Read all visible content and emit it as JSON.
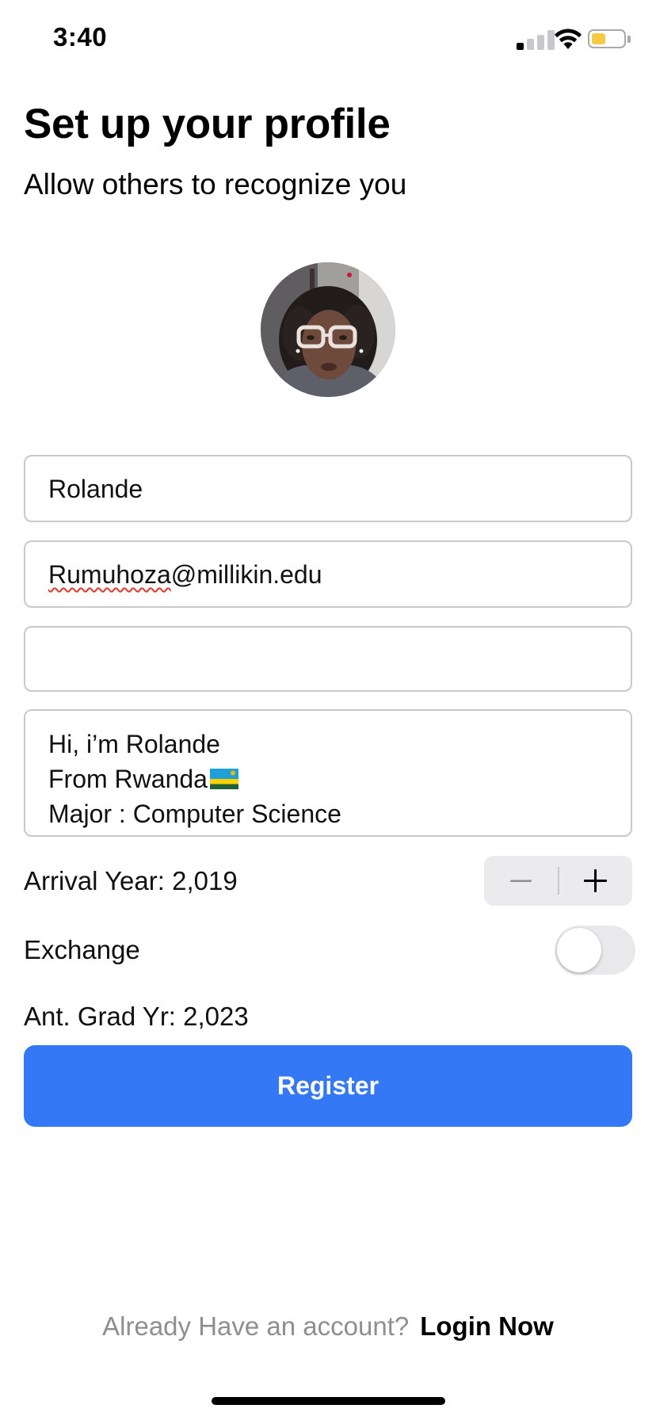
{
  "status_bar": {
    "time": "3:40",
    "battery_level": 0.45,
    "battery_color": "#f6c944",
    "icons": [
      "cellular-signal-icon",
      "wifi-icon",
      "battery-icon"
    ]
  },
  "header": {
    "title": "Set up your profile",
    "subtitle": "Allow others to recognize you"
  },
  "avatar": {
    "icon": "profile-photo"
  },
  "form": {
    "name_value": "Rolande",
    "email_user": "Rumuhoza",
    "email_domain": "@millikin.edu",
    "third_field_value": "",
    "bio_lines": [
      "Hi, i’m Rolande",
      "From Rwanda",
      "Major : Computer Science"
    ],
    "bio_flag_icon": "rwanda-flag-icon",
    "arrival_year_label": "Arrival Year: 2,019",
    "stepper_icons": [
      "minus-icon",
      "plus-icon"
    ],
    "exchange_label": "Exchange",
    "exchange_on": false,
    "grad_year_label": "Ant. Grad Yr: 2,023"
  },
  "register": {
    "label": "Register",
    "color": "#3478f6"
  },
  "footer": {
    "prompt": "Already Have an account?",
    "link": "Login Now"
  }
}
